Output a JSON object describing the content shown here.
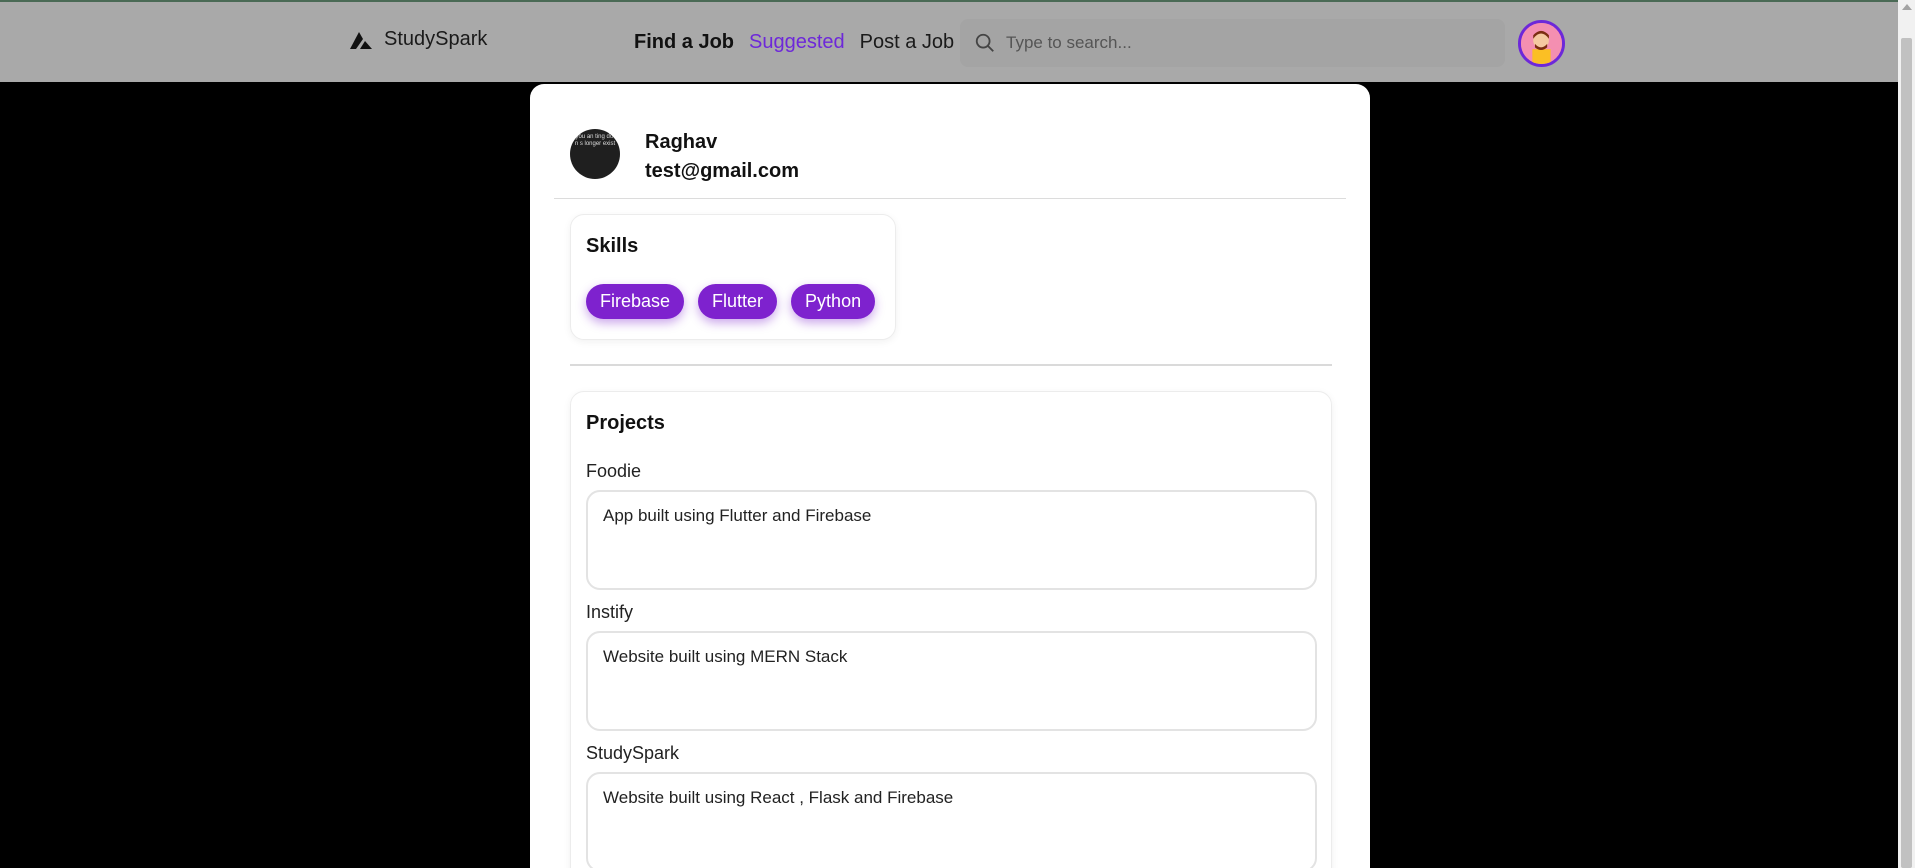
{
  "nav": {
    "brand": "StudySpark",
    "links": [
      "Find a Job",
      "Suggested",
      "Post a Job"
    ],
    "search_placeholder": "Type to search..."
  },
  "profile": {
    "name": "Raghav",
    "email": "test@gmail.com",
    "avatar_text": "e you an ting does n s longer exist"
  },
  "skills": {
    "title": "Skills",
    "items": [
      "Firebase",
      "Flutter",
      "Python"
    ]
  },
  "projects": {
    "title": "Projects",
    "items": [
      {
        "name": "Foodie",
        "description": "App built using Flutter and Firebase"
      },
      {
        "name": "Instify",
        "description": "Website built using MERN Stack"
      },
      {
        "name": "StudySpark",
        "description": "Website built using React , Flask and Firebase"
      }
    ]
  },
  "colors": {
    "accent": "#7e22ce",
    "nav_bg": "#a9a9a9",
    "page_bg": "#000000"
  }
}
